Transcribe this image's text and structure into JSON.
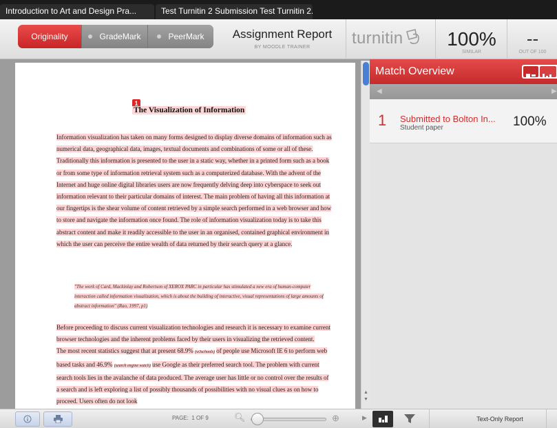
{
  "browser_tabs": [
    {
      "label": "Introduction to Art and Design Pra..."
    },
    {
      "label": "Test Turnitin 2 Submission Test Turnitin 2.•."
    }
  ],
  "modes": {
    "originality": "Originality",
    "grademark": "GradeMark",
    "peermark": "PeerMark"
  },
  "report": {
    "title": "Assignment Report",
    "subtitle": "BY MOODLE TRAINER"
  },
  "brand": {
    "logo_text": "turnitin"
  },
  "similarity": {
    "value": "100%",
    "label": "SIMILAR"
  },
  "grade": {
    "value": "--",
    "label": "OUT OF 100"
  },
  "document": {
    "match_marker": "1",
    "title": "The Visualization of Information",
    "paragraph_1": "Information visualization has taken on many forms designed to display diverse domains of information such as numerical data, geographical data, images, textual documents and combinations of some or all of these. Traditionally this information is presented to the user in a static way, whether in a printed form such as a book or from some type of information retrieval system such as a computerized database. With the advent of the Internet and huge online digital libraries users are now frequently delving deep into cyberspace to seek out information relevant to their particular domains of interest. The main problem of having all this information at our fingertips is the shear volume of content retrieved by a simple search performed in a web browser and how to store and navigate the information once found. The role of information visualization today is to take this abstract content and make it readily accessible to the user in an organised, contained graphical environment in which the user can perceive the entire wealth of data returned by their search query at a glance.",
    "quote": "\"The work of Card, Mackinlay and Robertson of XEROX PARC in particular has stimulated a new era of human-computer interaction called information visualization, which is about the building of interactive, visual representations of large amounts of abstract information\" (Rao, 1997, p1)",
    "paragraph_2": "Before proceeding to discuss current visualization technologies and research it is necessary to examine current browser technologies and the inherent problems faced by their users in visualizing the retrieved content.",
    "paragraph_3a": "The most recent statistics suggest that at present 68.9%",
    "paragraph_3_note1": "(w3schools)",
    "paragraph_3b": "of people use Microsoft IE 6 to perform web based tasks and 46.9%",
    "paragraph_3_note2": "(search engine watch)",
    "paragraph_3c": "use Google as their preferred search tool. The problem with current search tools lies in the avalanche of data produced. The average user has little or no control over the results of a search and is left exploring a list of possibly thousands of possibilities with no visual clues as on how to proceed. Users often do not look"
  },
  "doc_toolbar": {
    "info_icon": "info-icon",
    "print_icon": "print-icon",
    "page_label": "PAGE:",
    "page_value": "1 OF 9",
    "zoom_level": 0.0
  },
  "match_overview": {
    "title": "Match Overview",
    "matches": [
      {
        "number": "1",
        "source": "Submitted to Bolton In...",
        "type": "Student paper",
        "percent": "100%"
      }
    ]
  },
  "side_toolbar": {
    "text_only": "Text-Only Report"
  },
  "colors": {
    "accent_red": "#d42a2a",
    "highlight": "#ffd3d3",
    "scroll_blue": "#4a7fd6"
  }
}
